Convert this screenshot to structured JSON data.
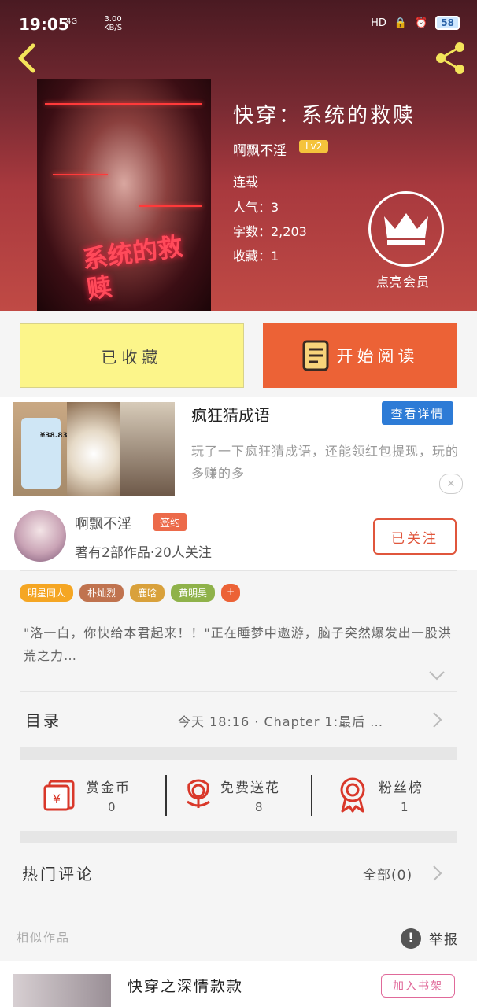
{
  "status_bar": {
    "time": "19:05",
    "network": "4G",
    "speed_value": "3.00",
    "speed_unit": "KB/S",
    "hd_label": "HD",
    "battery": "58"
  },
  "book": {
    "title": "快穿：系统的救赎",
    "author": "啊飘不淫",
    "level": "Lv2",
    "status": "连载",
    "popularity": "人气：3",
    "word_count": "字数：2,203",
    "favorites": "收藏：1",
    "cover_text": "系统的救赎"
  },
  "vip": {
    "label": "点亮会员"
  },
  "actions": {
    "collected": "已收藏",
    "start_reading": "开始阅读"
  },
  "ad": {
    "title": "疯狂猜成语",
    "detail_button": "查看详情",
    "description": "玩了一下疯狂猜成语，还能领红包提现，玩的多赚的多",
    "price": "¥38.83",
    "close": "✕"
  },
  "author": {
    "name": "啊飘不淫",
    "badge": "签约",
    "works": "著有2部作品·20人关注",
    "follow_button": "已关注"
  },
  "tags": [
    {
      "label": "明星同人",
      "color": "#f5a623"
    },
    {
      "label": "朴灿烈",
      "color": "#c0734f"
    },
    {
      "label": "鹿晗",
      "color": "#d9a13b"
    },
    {
      "label": "黄明昊",
      "color": "#8fb24a"
    },
    {
      "label": "+",
      "color": "#ec6236"
    }
  ],
  "summary": "\"洛一白，你快给本君起来！！\"正在睡梦中遨游，脑子突然爆发出一股洪荒之力…",
  "toc": {
    "label": "目录",
    "latest": "今天 18:16 · Chapter 1:最后 …"
  },
  "stats": [
    {
      "label": "赏金币",
      "value": "0",
      "icon": "red-envelope-icon"
    },
    {
      "label": "免费送花",
      "value": "8",
      "icon": "flower-icon"
    },
    {
      "label": "粉丝榜",
      "value": "1",
      "icon": "medal-icon"
    }
  ],
  "comments": {
    "label": "热门评论",
    "all": "全部(0)"
  },
  "similar": {
    "label": "相似作品",
    "report": "举报",
    "report_icon": "!"
  },
  "similar_book": {
    "title": "快穿之深情款款",
    "add_button": "加入书架"
  },
  "colors": {
    "accent_orange": "#ec6236",
    "collected_yellow": "#fcf58a",
    "ad_blue": "#2d7bd6"
  }
}
